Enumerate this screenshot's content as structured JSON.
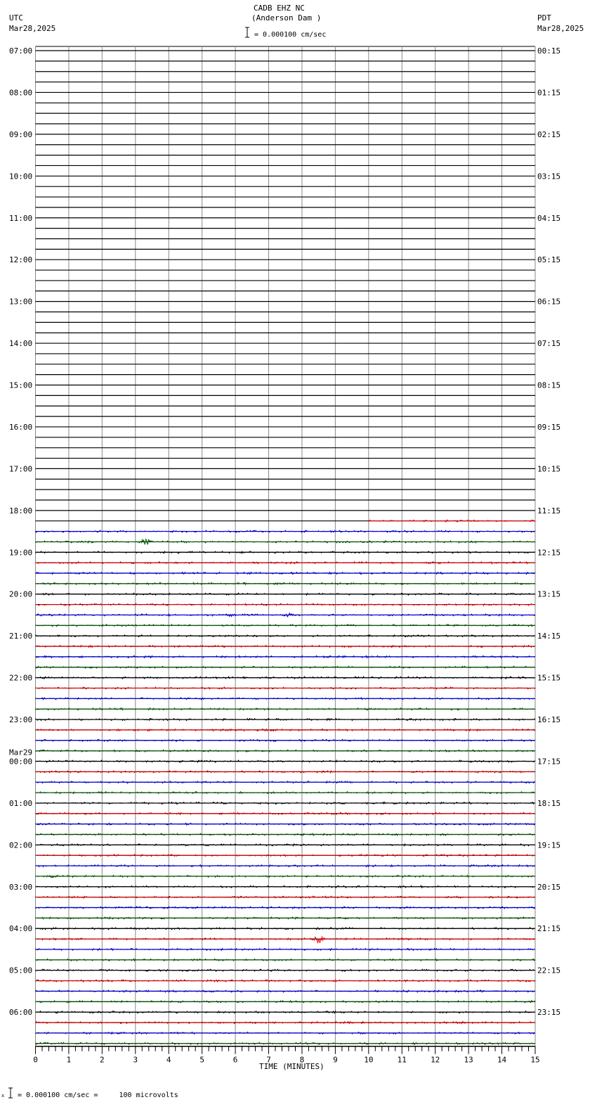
{
  "chart_data": {
    "type": "line",
    "title": "CADB EHZ NC",
    "subtitle": "(Anderson Dam )",
    "scale_label": "= 0.000100 cm/sec",
    "left_tz": "UTC",
    "left_date": "Mar28,2025",
    "right_tz": "PDT",
    "right_date": "Mar28,2025",
    "xlabel": "TIME (MINUTES)",
    "xlim": [
      0,
      15
    ],
    "x_ticks": [
      "0",
      "1",
      "2",
      "3",
      "4",
      "5",
      "6",
      "7",
      "8",
      "9",
      "10",
      "11",
      "12",
      "13",
      "14",
      "15"
    ],
    "left_hour_labels": [
      "07:00",
      "08:00",
      "09:00",
      "10:00",
      "11:00",
      "12:00",
      "13:00",
      "14:00",
      "15:00",
      "16:00",
      "17:00",
      "18:00",
      "19:00",
      "20:00",
      "21:00",
      "22:00",
      "23:00",
      "00:00",
      "01:00",
      "02:00",
      "03:00",
      "04:00",
      "05:00",
      "06:00"
    ],
    "date_change_label": "Mar29",
    "date_change_hour_index": 17,
    "right_hour_labels": [
      "00:15",
      "01:15",
      "02:15",
      "03:15",
      "04:15",
      "05:15",
      "06:15",
      "07:15",
      "08:15",
      "09:15",
      "10:15",
      "11:15",
      "12:15",
      "13:15",
      "14:15",
      "15:15",
      "16:15",
      "17:15",
      "18:15",
      "19:15",
      "20:15",
      "21:15",
      "22:15",
      "23:15"
    ],
    "traces_per_hour": 4,
    "trace_colors": [
      "#000000",
      "#ff0000",
      "#0000ff",
      "#006400"
    ],
    "data_start": {
      "trace_index": 45,
      "minute": 10
    },
    "events": [
      {
        "trace_index": 47,
        "minute": 3.3,
        "amplitude": 6
      },
      {
        "trace_index": 54,
        "minute": 5.8,
        "amplitude": 2
      },
      {
        "trace_index": 54,
        "minute": 7.6,
        "amplitude": 2.5
      },
      {
        "trace_index": 79,
        "minute": 0.5,
        "amplitude": 2
      },
      {
        "trace_index": 85,
        "minute": 8.5,
        "amplitude": 6
      }
    ],
    "footer": "= 0.000100 cm/sec =     100 microvolts",
    "footer_mark": "x"
  }
}
